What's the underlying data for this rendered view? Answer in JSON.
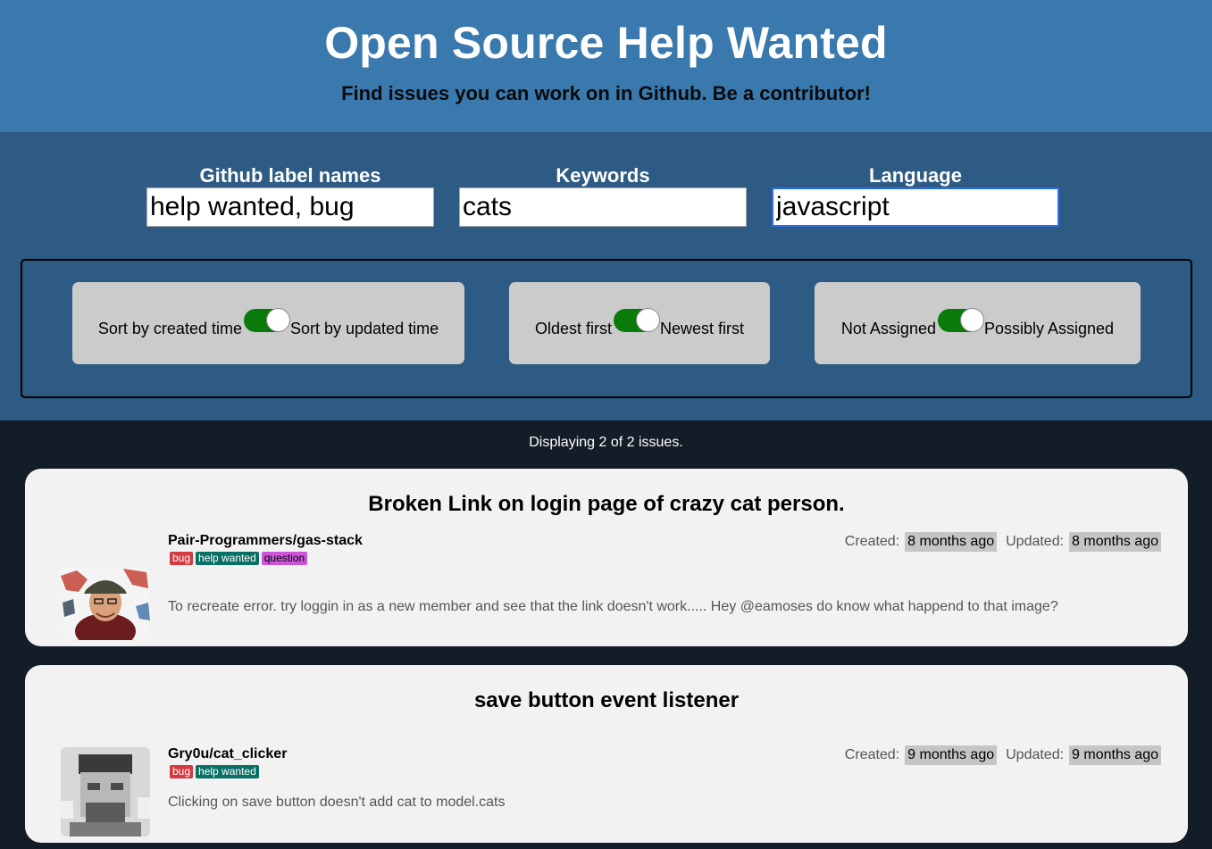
{
  "header": {
    "title": "Open Source Help Wanted",
    "subtitle": "Find issues you can work on in Github. Be a contributor!"
  },
  "filters": {
    "labels": {
      "label": "Github label names",
      "value": "help wanted, bug"
    },
    "keywords": {
      "label": "Keywords",
      "value": "cats"
    },
    "language": {
      "label": "Language",
      "value": "javascript"
    }
  },
  "toggles": [
    {
      "left": "Sort by created time",
      "right": "Sort by updated time",
      "on": true
    },
    {
      "left": "Oldest first",
      "right": "Newest first",
      "on": true
    },
    {
      "left": "Not Assigned",
      "right": "Possibly Assigned",
      "on": true
    }
  ],
  "status": "Displaying 2 of 2 issues.",
  "issues": [
    {
      "title": "Broken Link on login page of crazy cat person.",
      "repo": "Pair-Programmers/gas-stack",
      "tags": [
        "bug",
        "help wanted",
        "question"
      ],
      "created_label": "Created:",
      "created": "8 months ago",
      "updated_label": "Updated:",
      "updated": "8 months ago",
      "body": "To recreate error.  try loggin in as a new member and see that the link doesn't work.....  Hey @eamoses do know what happend to that image?"
    },
    {
      "title": "save button event listener",
      "repo": "Gry0u/cat_clicker",
      "tags": [
        "bug",
        "help wanted"
      ],
      "created_label": "Created:",
      "created": "9 months ago",
      "updated_label": "Updated:",
      "updated": "9 months ago",
      "body": "Clicking on save button doesn't add cat to model.cats"
    }
  ],
  "colors": {
    "header_bg": "#3a79ad",
    "controls_bg": "#2e5b83",
    "page_bg": "#131c27",
    "toggle_on": "#0a7a0a",
    "tag_bug": "#d33a43",
    "tag_help_wanted": "#0a7066",
    "tag_question": "#cc56d8"
  }
}
